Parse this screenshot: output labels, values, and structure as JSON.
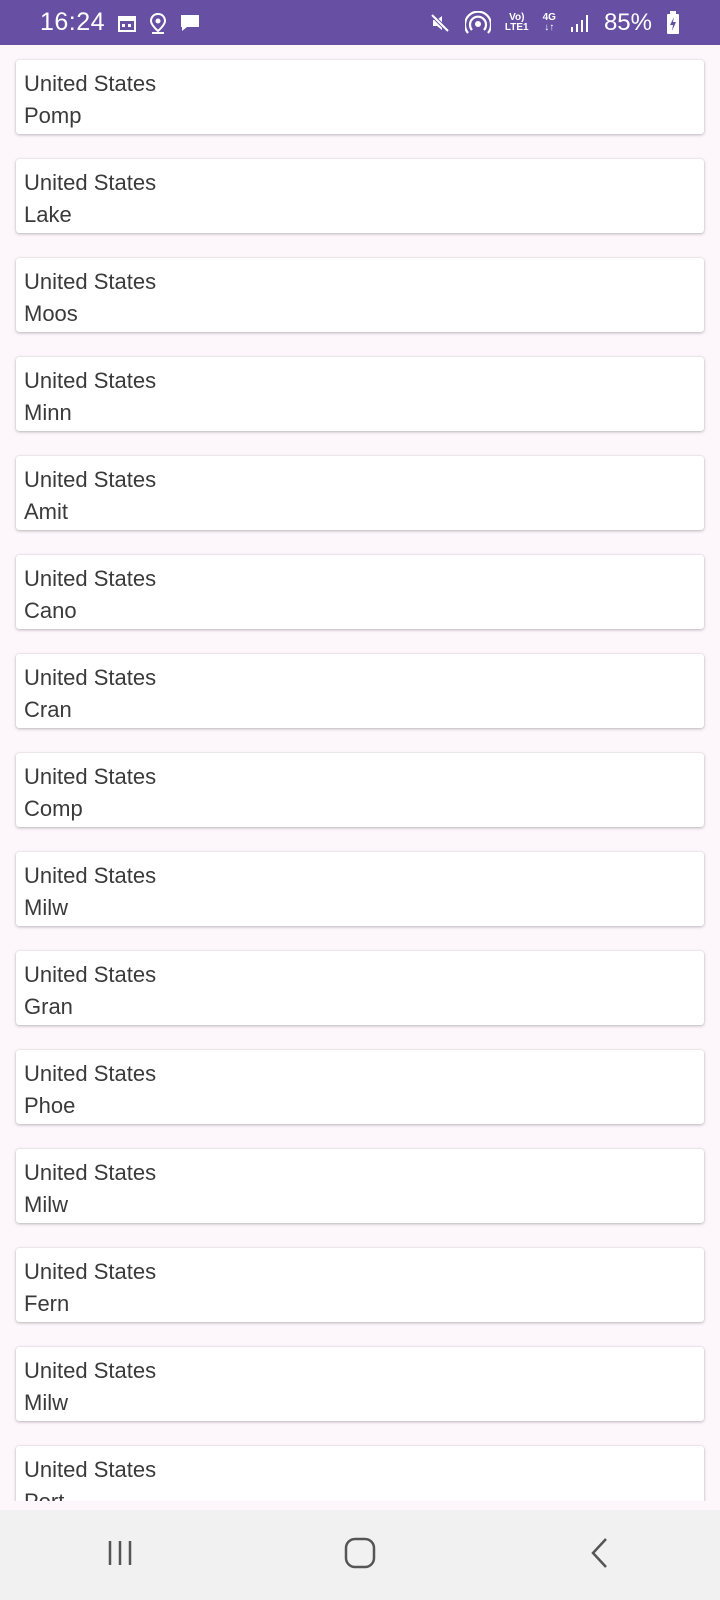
{
  "status_bar": {
    "time": "16:24",
    "network_label_top": "Vo)",
    "network_label_bottom": "LTE1",
    "network_4g": "4G",
    "battery": "85%",
    "background_color": "#6750a4"
  },
  "list": {
    "items": [
      {
        "country": "United States",
        "city": "Pomp"
      },
      {
        "country": "United States",
        "city": "Lake"
      },
      {
        "country": "United States",
        "city": "Moos"
      },
      {
        "country": "United States",
        "city": "Minn"
      },
      {
        "country": "United States",
        "city": "Amit"
      },
      {
        "country": "United States",
        "city": "Cano"
      },
      {
        "country": "United States",
        "city": "Cran"
      },
      {
        "country": "United States",
        "city": "Comp"
      },
      {
        "country": "United States",
        "city": "Milw"
      },
      {
        "country": "United States",
        "city": "Gran"
      },
      {
        "country": "United States",
        "city": "Phoe"
      },
      {
        "country": "United States",
        "city": "Milw"
      },
      {
        "country": "United States",
        "city": "Fern"
      },
      {
        "country": "United States",
        "city": "Milw"
      },
      {
        "country": "United States",
        "city": "Port"
      }
    ]
  },
  "nav_bar": {
    "icons": [
      "recent-apps-icon",
      "home-icon",
      "back-icon"
    ]
  }
}
